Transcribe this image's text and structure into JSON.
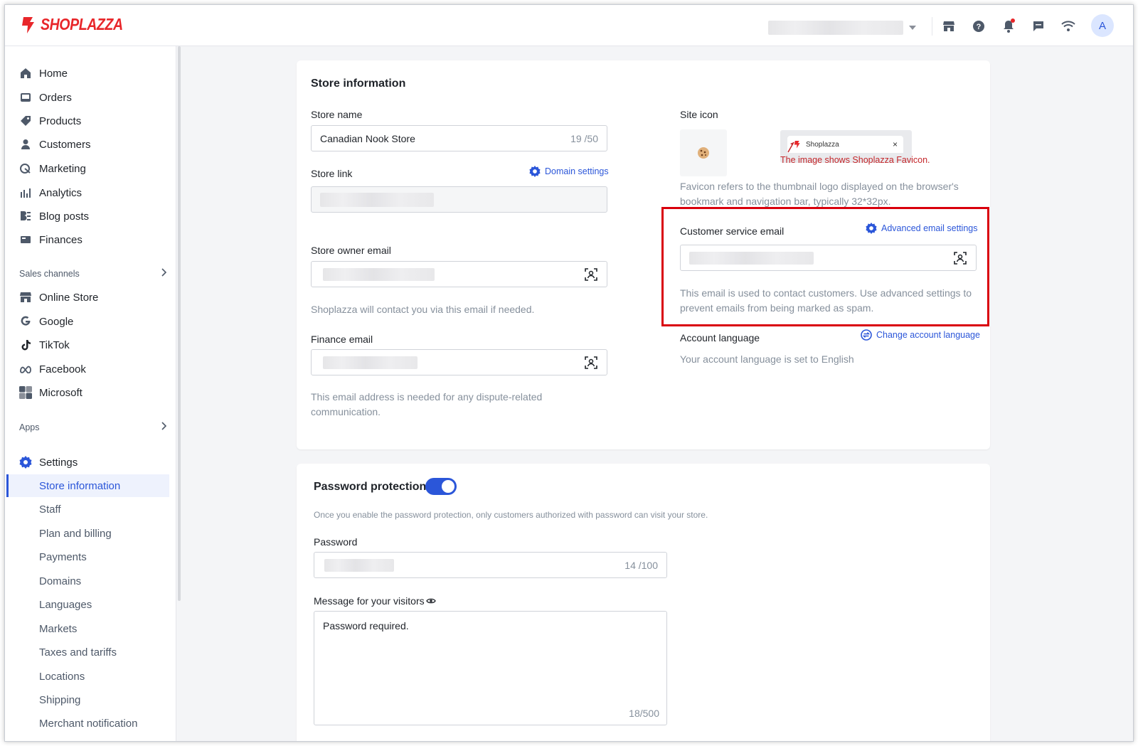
{
  "app": {
    "logo_text": "SHOPLAZZA",
    "avatar_initial": "A"
  },
  "topbar": {
    "icons": [
      "store-icon",
      "help-icon",
      "bell-icon",
      "message-icon",
      "wifi-icon"
    ]
  },
  "sidebar": {
    "main_items": [
      {
        "label": "Home",
        "icon": "home-icon"
      },
      {
        "label": "Orders",
        "icon": "orders-icon"
      },
      {
        "label": "Products",
        "icon": "tag-icon"
      },
      {
        "label": "Customers",
        "icon": "person-icon"
      },
      {
        "label": "Marketing",
        "icon": "marketing-icon"
      },
      {
        "label": "Analytics",
        "icon": "bar-chart-icon"
      },
      {
        "label": "Blog posts",
        "icon": "blog-icon"
      },
      {
        "label": "Finances",
        "icon": "finances-icon"
      }
    ],
    "sales_channels_label": "Sales channels",
    "channels": [
      {
        "label": "Online Store",
        "icon": "store-icon"
      },
      {
        "label": "Google",
        "icon": "google-icon"
      },
      {
        "label": "TikTok",
        "icon": "tiktok-icon"
      },
      {
        "label": "Facebook",
        "icon": "meta-icon"
      },
      {
        "label": "Microsoft",
        "icon": "microsoft-icon"
      }
    ],
    "apps_label": "Apps",
    "settings_label": "Settings",
    "settings_items": [
      "Store information",
      "Staff",
      "Plan and billing",
      "Payments",
      "Domains",
      "Languages",
      "Markets",
      "Taxes and tariffs",
      "Locations",
      "Shipping",
      "Merchant notification"
    ],
    "active_item": "Store information"
  },
  "store_info": {
    "title": "Store information",
    "store_name_label": "Store name",
    "store_name_value": "Canadian Nook Store",
    "store_name_count": "19 /50",
    "store_link_label": "Store link",
    "domain_settings_link": "Domain settings",
    "owner_email_label": "Store owner email",
    "owner_email_help": "Shoplazza will contact you via this email if needed.",
    "finance_email_label": "Finance email",
    "finance_email_help": "This email address is needed for any dispute-related communication.",
    "site_icon_label": "Site icon",
    "favicon_tab_label": "Shoplazza",
    "favicon_tab_close": "×",
    "favicon_note": "The image shows Shoplazza Favicon.",
    "favicon_help": "Favicon refers to the thumbnail logo displayed on the browser's bookmark and navigation bar, typically 32*32px.",
    "cs_email_label": "Customer service email",
    "advanced_email_link": "Advanced email settings",
    "cs_email_help": "This email is used to contact customers. Use advanced settings to prevent emails from being marked as spam.",
    "account_language_label": "Account language",
    "change_language_link": "Change account language",
    "account_language_value": "Your account language is set to English"
  },
  "password_protection": {
    "title": "Password protection",
    "enabled": true,
    "description": "Once you enable the password protection, only customers authorized with password can visit your store.",
    "password_label": "Password",
    "password_count": "14 /100",
    "message_label": "Message for your visitors",
    "message_value": "Password required.",
    "message_count": "18/500"
  },
  "colors": {
    "accent": "#2b56d9",
    "brand": "#e8262a",
    "highlight": "#d9000c"
  }
}
